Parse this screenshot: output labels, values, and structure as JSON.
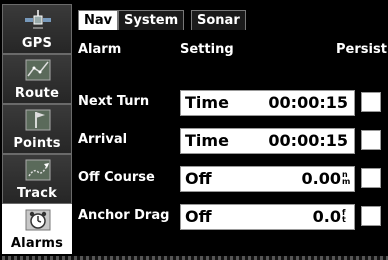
{
  "sidebar": {
    "items": [
      {
        "label": "GPS",
        "icon": "satellite-icon",
        "active": false
      },
      {
        "label": "Route",
        "icon": "route-map-icon",
        "active": false
      },
      {
        "label": "Points",
        "icon": "waypoint-flag-icon",
        "active": false
      },
      {
        "label": "Track",
        "icon": "track-boat-icon",
        "active": false
      },
      {
        "label": "Alarms",
        "icon": "alarm-clock-icon",
        "active": true
      }
    ]
  },
  "tabs": [
    {
      "label": "Nav",
      "active": true
    },
    {
      "label": "System",
      "active": false
    },
    {
      "label": "Sonar",
      "active": false
    }
  ],
  "columns": {
    "alarm": "Alarm",
    "setting": "Setting",
    "persist": "Persist"
  },
  "alarms": [
    {
      "label": "Next Turn",
      "mode": "Time",
      "value": "00:00:15",
      "unit": "",
      "persist": false
    },
    {
      "label": "Arrival",
      "mode": "Time",
      "value": "00:00:15",
      "unit": "",
      "persist": false
    },
    {
      "label": "Off Course",
      "mode": "Off",
      "value": "0.00",
      "unit": "n m",
      "persist": false
    },
    {
      "label": "Anchor Drag",
      "mode": "Off",
      "value": "0.0",
      "unit": "f t",
      "persist": false
    }
  ],
  "colors": {
    "background": "#000000",
    "active": "#ffffff",
    "text": "#ffffff"
  }
}
